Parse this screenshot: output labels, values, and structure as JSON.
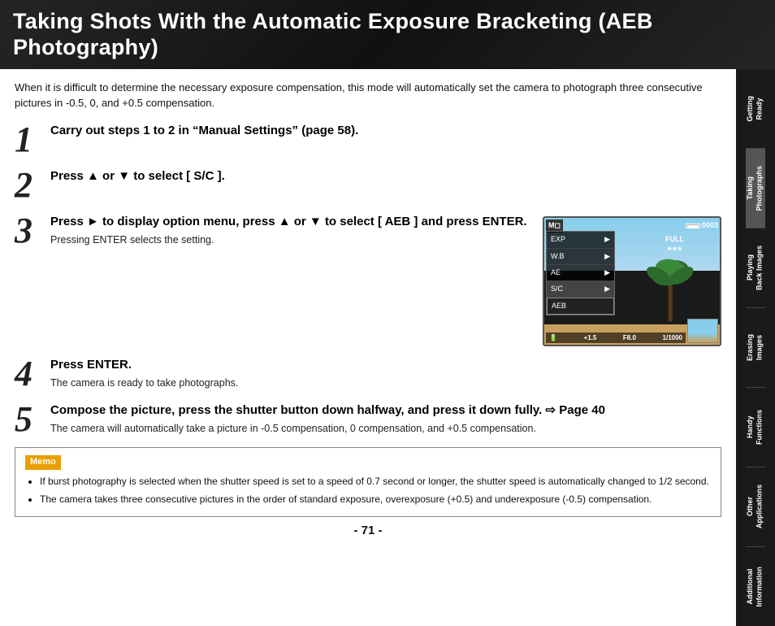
{
  "header": {
    "title": "Taking Shots With the Automatic Exposure Bracketing (AEB Photography)"
  },
  "intro": {
    "text": "When it is difficult to determine the necessary exposure compensation, this mode will automatically set the camera to photograph three consecutive pictures in -0.5, 0, and +0.5 compensation."
  },
  "steps": [
    {
      "number": "1",
      "title": "Carry out steps 1 to 2 in “Manual Settings” (page 58).",
      "desc": ""
    },
    {
      "number": "2",
      "title": "Press ▲ or ▼ to select [ S/C ].",
      "desc": ""
    },
    {
      "number": "3",
      "title": "Press ► to display option menu, press ▲ or ▼ to select  [ AEB ] and press ENTER.",
      "desc": "Pressing ENTER selects the setting."
    },
    {
      "number": "4",
      "title": "Press ENTER.",
      "desc": "The camera is ready to take photographs."
    },
    {
      "number": "5",
      "title": "Compose the picture, press the shutter button down halfway, and press it down fully. ⇨ Page 40",
      "desc": "The camera will automatically take a picture in -0.5 compensation, 0 compensation, and +0.5 compensation."
    }
  ],
  "camera_display": {
    "frame_count": "0003",
    "menu_items": [
      {
        "label": "EXP",
        "arrow": "▶",
        "selected": false
      },
      {
        "label": "W.B",
        "arrow": "▶",
        "selected": false
      },
      {
        "label": "AE",
        "arrow": "▶",
        "selected": false
      },
      {
        "label": "S/C",
        "arrow": "▶",
        "selected": true
      },
      {
        "label": "AEB",
        "arrow": "",
        "selected": false,
        "highlighted": true
      }
    ],
    "full_label": "FULL",
    "stars": "★★★",
    "bottom_value": "+1.5",
    "aperture": "F8.0",
    "shutter": "1/1000"
  },
  "memo": {
    "label": "Memo",
    "items": [
      "If burst photography is selected when the shutter speed is set to a speed of 0.7 second or longer, the shutter speed is automatically changed to 1/2 second.",
      "The camera takes three consecutive pictures in the order of standard exposure, overexposure (+0.5) and underexposure (-0.5) compensation."
    ]
  },
  "page_number": "- 71 -",
  "sidebar": {
    "sections": [
      {
        "label": "Getting\nReady",
        "active": false
      },
      {
        "label": "Taking\nPhotographs",
        "active": true
      },
      {
        "label": "Playing\nBack Images",
        "active": false
      },
      {
        "label": "Erasing\nImages",
        "active": false
      },
      {
        "label": "Handy\nFunctions",
        "active": false
      },
      {
        "label": "Other\nApplications",
        "active": false
      },
      {
        "label": "Additional\nInformation",
        "active": false
      }
    ]
  }
}
